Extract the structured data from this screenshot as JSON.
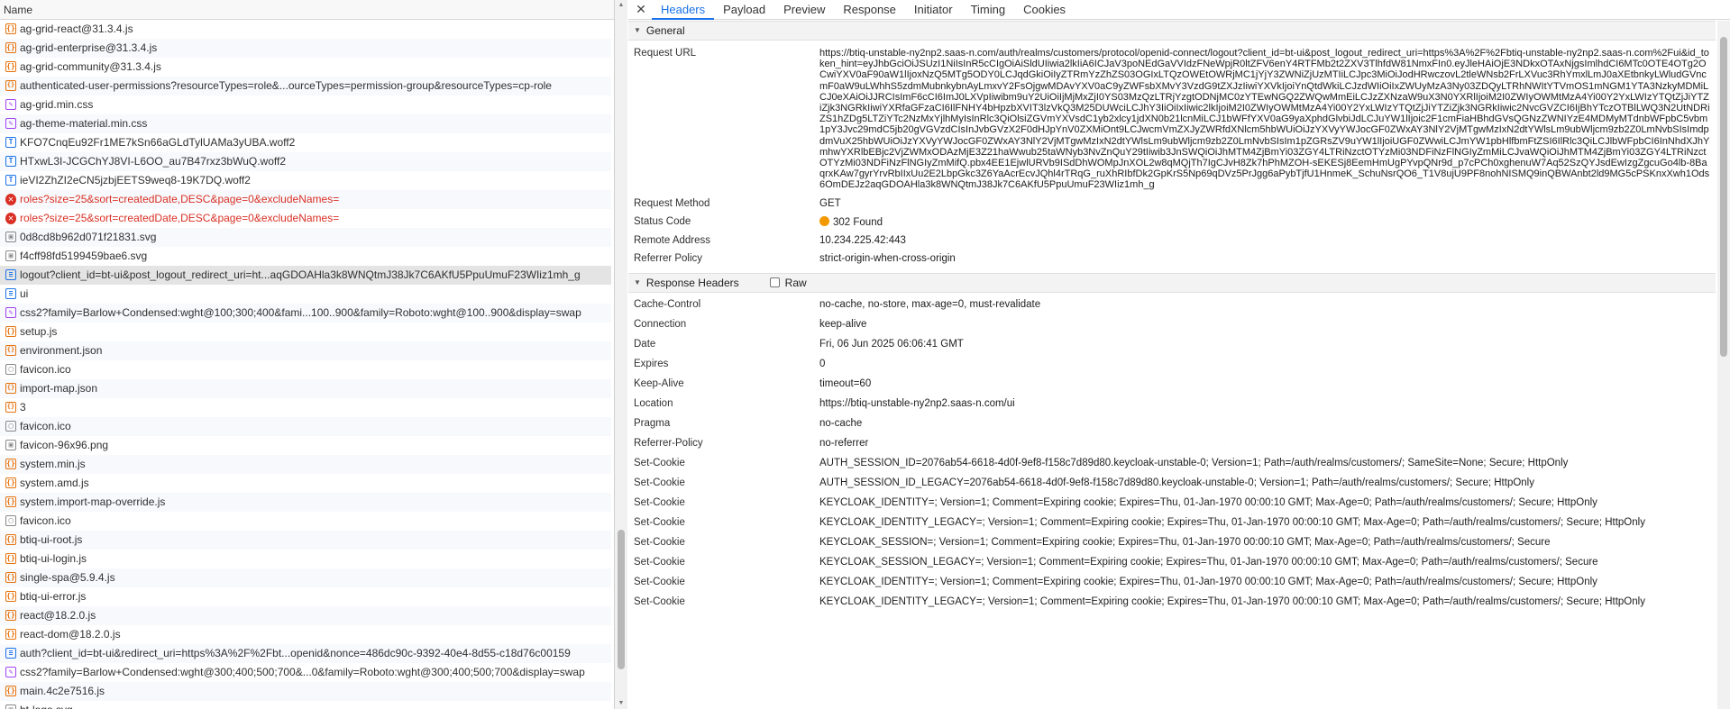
{
  "list": {
    "header": "Name",
    "rows": [
      {
        "label": "ag-grid-react@31.3.4.js",
        "type": "js"
      },
      {
        "label": "ag-grid-enterprise@31.3.4.js",
        "type": "js"
      },
      {
        "label": "ag-grid-community@31.3.4.js",
        "type": "js"
      },
      {
        "label": "authenticated-user-permissions?resourceTypes=role&...ourceTypes=permission-group&resourceTypes=cp-role",
        "type": "json"
      },
      {
        "label": "ag-grid.min.css",
        "type": "css"
      },
      {
        "label": "ag-theme-material.min.css",
        "type": "css"
      },
      {
        "label": "KFO7CnqEu92Fr1ME7kSn66aGLdTylUAMa3yUBA.woff2",
        "type": "font"
      },
      {
        "label": "HTxwL3I-JCGChYJ8VI-L6OO_au7B47rxz3bWuQ.woff2",
        "type": "font"
      },
      {
        "label": "ieVI2ZhZI2eCN5jzbjEETS9weq8-19K7DQ.woff2",
        "type": "font"
      },
      {
        "label": "roles?size=25&sort=createdDate,DESC&page=0&excludeNames=",
        "type": "error"
      },
      {
        "label": "roles?size=25&sort=createdDate,DESC&page=0&excludeNames=",
        "type": "error"
      },
      {
        "label": "0d8cd8b962d071f21831.svg",
        "type": "img"
      },
      {
        "label": "f4cff98fd5199459bae6.svg",
        "type": "img"
      },
      {
        "label": "logout?client_id=bt-ui&post_logout_redirect_uri=ht...aqGDOAHla3k8WNQtmJ38Jk7C6AKfU5PpuUmuF23WIiz1mh_g",
        "type": "doc",
        "selected": true
      },
      {
        "label": "ui",
        "type": "doc"
      },
      {
        "label": "css2?family=Barlow+Condensed:wght@100;300;400&fami...100..900&family=Roboto:wght@100..900&display=swap",
        "type": "css"
      },
      {
        "label": "setup.js",
        "type": "js"
      },
      {
        "label": "environment.json",
        "type": "json"
      },
      {
        "label": "favicon.ico",
        "type": "other"
      },
      {
        "label": "import-map.json",
        "type": "json"
      },
      {
        "label": "3",
        "type": "json"
      },
      {
        "label": "favicon.ico",
        "type": "other"
      },
      {
        "label": "favicon-96x96.png",
        "type": "img"
      },
      {
        "label": "system.min.js",
        "type": "js"
      },
      {
        "label": "system.amd.js",
        "type": "js"
      },
      {
        "label": "system.import-map-override.js",
        "type": "js"
      },
      {
        "label": "favicon.ico",
        "type": "other"
      },
      {
        "label": "btiq-ui-root.js",
        "type": "js"
      },
      {
        "label": "btiq-ui-login.js",
        "type": "js"
      },
      {
        "label": "single-spa@5.9.4.js",
        "type": "js"
      },
      {
        "label": "btiq-ui-error.js",
        "type": "js"
      },
      {
        "label": "react@18.2.0.js",
        "type": "js"
      },
      {
        "label": "react-dom@18.2.0.js",
        "type": "js"
      },
      {
        "label": "auth?client_id=bt-ui&redirect_uri=https%3A%2F%2Fbt...openid&nonce=486dc90c-9392-40e4-8d55-c18d76c00159",
        "type": "doc"
      },
      {
        "label": "css2?family=Barlow+Condensed:wght@300;400;500;700&...0&family=Roboto:wght@300;400;500;700&display=swap",
        "type": "css"
      },
      {
        "label": "main.4c2e7516.js",
        "type": "js"
      },
      {
        "label": "bt-logo.svg",
        "type": "img"
      }
    ]
  },
  "tabs": {
    "close": "✕",
    "items": [
      "Headers",
      "Payload",
      "Preview",
      "Response",
      "Initiator",
      "Timing",
      "Cookies"
    ],
    "active": "Headers"
  },
  "general": {
    "title": "General",
    "request_url_label": "Request URL",
    "request_url": "https://btiq-unstable-ny2np2.saas-n.com/auth/realms/customers/protocol/openid-connect/logout?client_id=bt-ui&post_logout_redirect_uri=https%3A%2F%2Fbtiq-unstable-ny2np2.saas-n.com%2Fui&id_token_hint=eyJhbGciOiJSUzI1NiIsInR5cCIgOiAiSldUIiwia2lkIiA6ICJaV3poNEdGaVVIdzFNeWpjR0ltZFV6enY4RTFMb2t2ZXV3TlhfdW81NmxFIn0.eyJleHAiOjE3NDkxOTAxNjgsImlhdCI6MTc0OTE4OTg2OCwiYXV0aF90aW1lIjoxNzQ5MTg5ODY0LCJqdGkiOiIyZTRmYzZhZS03OGIxLTQzOWEtOWRjMC1jYjY3ZWNiZjUzMTIiLCJpc3MiOiJodHRwczovL2tleWNsb2FrLXVuc3RhYmxlLmJ0aXEtbnkyLWludGVncmF0aW9uLWhhS5zdmMubnkybnAyLmxvY2FsOjgwMDAvYXV0aC9yZWFsbXMvY3VzdG9tZXJzIiwiYXVkIjoiYnQtdWkiLCJzdWIiOiIxZWUyMzA3Ny03ZDQyLTRhNWItYTVmOS1mNGM1YTA3NzkyMDMiLCJ0eXAiOiJJRCIsImF6cCI6ImJ0LXVpIiwibm9uY2UiOiIjMjMxZjI0YS03MzQzLTRjYzgtODNjMC0zYTEwNGQ2ZWQwMmEiLCJzZXNzaW9uX3N0YXRlIjoiM2I0ZWIyOWMtMzA4Yi00Y2YxLWIzYTQtZjJiYTZiZjk3NGRkIiwiYXRfaGFzaCI6IlFNHY4bHpzbXVIT3lzVkQ3M25DUWciLCJhY3IiOiIxIiwic2lkIjoiM2I0ZWIyOWMtMzA4Yi00Y2YxLWIzYTQtZjJiYTZiZjk3NGRkIiwic2NvcGVZCI6IjBhYTczOTBlLWQ3N2UtNDRiZS1hZDg5LTZiYTc2NzMxYjlhMyIsInRlc3QiOlsiZGVmYXVsdC1yb2xlcy1jdXN0b21lcnMiLCJ1bWFfYXV0aG9yaXphdGlvbiJdLCJuYW1lIjoic2F1cmFiaHBhdGVsQGNzZWNIYzE4MDMyMTdnbWFpbC5vbm1pY3Jvc29mdC5jb20gVGVzdCIsInJvbGVzX2F0dHJpYnV0ZXMiOnt9LCJwcmVmZXJyZWRfdXNlcm5hbWUiOiJzYXVyYWJocGF0ZWxAY3NlY2VjMTgwMzIxN2dtYWlsLm9ubWljcm9zb2Z0LmNvbSIsImdpdmVuX25hbWUiOiJzYXVyYWJocGF0ZWxAY3NlY2VjMTgwMzIxN2dtYWlsLm9ubWljcm9zb2Z0LmNvbSIsIm1pZGRsZV9uYW1lIjoiUGF0ZWwiLCJmYW1pbHlfbmFtZSI6IlRlc3QiLCJlbWFpbCI6InNhdXJhYmhwYXRlbEBjc2VjZWMxODAzMjE3Z21haWwub25taWNyb3NvZnQuY29tIiwib3JnSWQiOiJhMTM4ZjBmYi03ZGY4LTRiNzctOTYzMi03NDFiNzFlNGIyZmMiLCJvaWQiOiJhMTM4ZjBmYi03ZGY4LTRiNzctOTYzMi03NDFiNzFlNGIyZmMifQ.pbx4EE1EjwlURVb9ISdDhWOMpJnXOL2w8qMQjTh7IgCJvH8Zk7hPhMZOH-sEKESj8EemHmUgPYvpQNr9d_p7cPCh0xghenuW7Aq52SzQYJsdEwIzgZgcuGo4lb-8BaqrxKAw7gyrYrvRbIIxUu2E2LbpGkc3Z6YaAcrEcvJQhl4rTRqG_ruXhRIbfDk2GpKrS5Np69qDVz5PrJgg6aPybTjfU1HnmeK_SchuNsrQO6_T1V8ujU9PF8nohNISMQ9inQBWAnbt2ld9MG5cPSKnxXwh1Ods6OmDEJz2aqGDOAHla3k8WNQtmJ38Jk7C6AKfU5PpuUmuF23WIiz1mh_g",
    "request_method_label": "Request Method",
    "request_method": "GET",
    "status_code_label": "Status Code",
    "status_code": "302 Found",
    "status_color": "#f29900",
    "remote_address_label": "Remote Address",
    "remote_address": "10.234.225.42:443",
    "referrer_policy_label": "Referrer Policy",
    "referrer_policy": "strict-origin-when-cross-origin"
  },
  "response_headers": {
    "title": "Response Headers",
    "raw_label": "Raw",
    "items": [
      {
        "k": "Cache-Control",
        "v": "no-cache, no-store, max-age=0, must-revalidate"
      },
      {
        "k": "Connection",
        "v": "keep-alive"
      },
      {
        "k": "Date",
        "v": "Fri, 06 Jun 2025 06:06:41 GMT"
      },
      {
        "k": "Expires",
        "v": "0"
      },
      {
        "k": "Keep-Alive",
        "v": "timeout=60"
      },
      {
        "k": "Location",
        "v": "https://btiq-unstable-ny2np2.saas-n.com/ui"
      },
      {
        "k": "Pragma",
        "v": "no-cache"
      },
      {
        "k": "Referrer-Policy",
        "v": "no-referrer"
      },
      {
        "k": "Set-Cookie",
        "v": "AUTH_SESSION_ID=2076ab54-6618-4d0f-9ef8-f158c7d89d80.keycloak-unstable-0; Version=1; Path=/auth/realms/customers/; SameSite=None; Secure; HttpOnly"
      },
      {
        "k": "Set-Cookie",
        "v": "AUTH_SESSION_ID_LEGACY=2076ab54-6618-4d0f-9ef8-f158c7d89d80.keycloak-unstable-0; Version=1; Path=/auth/realms/customers/; Secure; HttpOnly"
      },
      {
        "k": "Set-Cookie",
        "v": "KEYCLOAK_IDENTITY=; Version=1; Comment=Expiring cookie; Expires=Thu, 01-Jan-1970 00:00:10 GMT; Max-Age=0; Path=/auth/realms/customers/; Secure; HttpOnly"
      },
      {
        "k": "Set-Cookie",
        "v": "KEYCLOAK_IDENTITY_LEGACY=; Version=1; Comment=Expiring cookie; Expires=Thu, 01-Jan-1970 00:00:10 GMT; Max-Age=0; Path=/auth/realms/customers/; Secure; HttpOnly"
      },
      {
        "k": "Set-Cookie",
        "v": "KEYCLOAK_SESSION=; Version=1; Comment=Expiring cookie; Expires=Thu, 01-Jan-1970 00:00:10 GMT; Max-Age=0; Path=/auth/realms/customers/; Secure"
      },
      {
        "k": "Set-Cookie",
        "v": "KEYCLOAK_SESSION_LEGACY=; Version=1; Comment=Expiring cookie; Expires=Thu, 01-Jan-1970 00:00:10 GMT; Max-Age=0; Path=/auth/realms/customers/; Secure"
      },
      {
        "k": "Set-Cookie",
        "v": "KEYCLOAK_IDENTITY=; Version=1; Comment=Expiring cookie; Expires=Thu, 01-Jan-1970 00:00:10 GMT; Max-Age=0; Path=/auth/realms/customers/; Secure; HttpOnly"
      },
      {
        "k": "Set-Cookie",
        "v": "KEYCLOAK_IDENTITY_LEGACY=; Version=1; Comment=Expiring cookie; Expires=Thu, 01-Jan-1970 00:00:10 GMT; Max-Age=0; Path=/auth/realms/customers/; Secure; HttpOnly"
      }
    ]
  }
}
